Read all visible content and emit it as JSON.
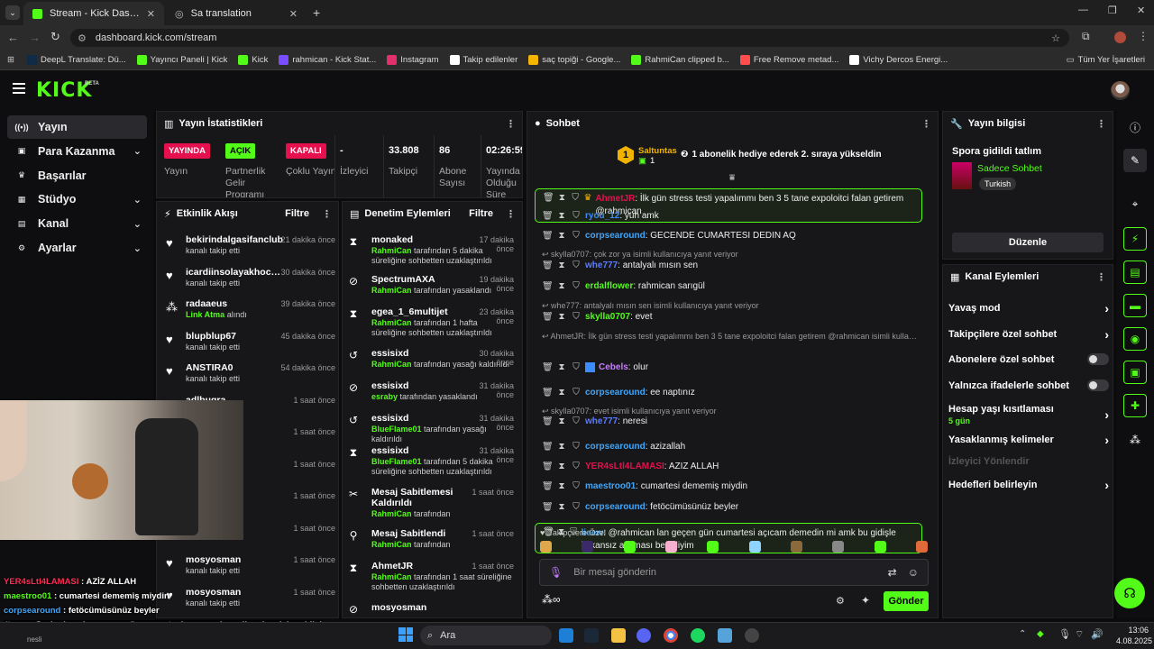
{
  "browser": {
    "tabs": [
      {
        "title": "Stream - Kick Dashboard",
        "active": true
      },
      {
        "title": "Sa translation",
        "active": false
      }
    ],
    "url": "dashboard.kick.com/stream",
    "bookmarks": [
      "DeepL Translate: Dü...",
      "Yayıncı Paneli | Kick",
      "Kick",
      "rahmican - Kick Stat...",
      "Instagram",
      "Takip edilenler",
      "saç topiği - Google...",
      "RahmiCan clipped b...",
      "Free Remove metad...",
      "Vichy Dercos Energi..."
    ],
    "all_bookmarks": "Tüm Yer İşaretleri"
  },
  "kick": {
    "logo": "KICK",
    "beta": "BETA"
  },
  "nav": {
    "items": [
      {
        "label": "Yayın",
        "icon": "broadcast-icon",
        "active": true
      },
      {
        "label": "Para Kazanma",
        "icon": "money-icon",
        "chevron": true
      },
      {
        "label": "Başarılar",
        "icon": "trophy-icon"
      },
      {
        "label": "Stüdyo",
        "icon": "studio-icon",
        "chevron": true
      },
      {
        "label": "Kanal",
        "icon": "channel-icon",
        "chevron": true
      },
      {
        "label": "Ayarlar",
        "icon": "gear-icon",
        "chevron": true
      }
    ]
  },
  "stats": {
    "title": "Yayın İstatistikleri",
    "items": [
      {
        "value": "YAYINDA",
        "label": "Yayın",
        "pill": "#e5104d"
      },
      {
        "value": "AÇIK",
        "label": "Partnerlik Gelir Programı",
        "pill": "#53fc18"
      },
      {
        "value": "KAPALI",
        "label": "Çoklu Yayın",
        "pill": "#e5104d"
      },
      {
        "value": "-",
        "label": "İzleyici"
      },
      {
        "value": "33.808",
        "label": "Takipçi"
      },
      {
        "value": "86",
        "label": "Abone Sayısı"
      },
      {
        "value": "02:26:59",
        "label": "Yayında Olduğu Süre"
      }
    ]
  },
  "activity": {
    "title": "Etkinlik Akışı",
    "filter": "Filtre",
    "items": [
      {
        "user": "bekirindalgasifanclub",
        "sub": "kanalı takip etti",
        "time": "21 dakika önce"
      },
      {
        "user": "icardiinsolayakhocam",
        "sub": "kanalı takip etti",
        "time": "30 dakika önce"
      },
      {
        "user": "radaaeus",
        "sub_green": "Link Atma",
        "sub": "alındı",
        "time": "39 dakika önce"
      },
      {
        "user": "blupblup67",
        "sub": "kanalı takip etti",
        "time": "45 dakika önce"
      },
      {
        "user": "ANSTIRA0",
        "sub": "kanalı takip etti",
        "time": "54 dakika önce"
      },
      {
        "user": "adlbugra",
        "sub": "",
        "time": "1 saat önce"
      },
      {
        "user": "213",
        "sub": "",
        "time": "1 saat önce"
      },
      {
        "user": "",
        "sub": "",
        "time": "1 saat önce"
      },
      {
        "user": "",
        "sub": "",
        "time": "1 saat önce"
      },
      {
        "user": "",
        "sub": "kanalı takip etti",
        "time": "1 saat önce"
      },
      {
        "user": "mosyosman",
        "sub": "kanalı takip etti",
        "time": "1 saat önce"
      },
      {
        "user": "mosyosman",
        "sub": "kanalı takip etti",
        "time": "1 saat önce"
      }
    ]
  },
  "moderation": {
    "title": "Denetim Eylemleri",
    "filter": "Filtre",
    "items": [
      {
        "user": "monaked",
        "by": "RahmiCan",
        "text": "tarafından 5 dakika süreliğine sohbetten uzaklaştırıldı",
        "time": "17 dakika önce",
        "icon": "hourglass-icon"
      },
      {
        "user": "SpectrumAXA",
        "by": "RahmiCan",
        "text": "tarafından yasaklandı",
        "time": "19 dakika önce",
        "icon": "ban-icon"
      },
      {
        "user": "egea_1_6multijet",
        "by": "RahmiCan",
        "text": "tarafından 1 hafta süreliğine sohbetten uzaklaştırıldı",
        "time": "23 dakika önce",
        "icon": "hourglass-icon"
      },
      {
        "user": "essisixd",
        "by": "RahmiCan",
        "text": "tarafından yasağı kaldırıldı",
        "time": "30 dakika önce",
        "icon": "undo-icon"
      },
      {
        "user": "essisixd",
        "by": "esraby",
        "text": "tarafından yasaklandı",
        "time": "31 dakika önce",
        "icon": "ban-icon"
      },
      {
        "user": "essisixd",
        "by": "BlueFlame01",
        "text": "tarafından yasağı kaldırıldı",
        "time": "31 dakika önce",
        "icon": "undo-icon"
      },
      {
        "user": "essisixd",
        "by": "BlueFlame01",
        "text": "tarafından 5 dakika süreliğine sohbetten uzaklaştırıldı",
        "time": "31 dakika önce",
        "icon": "hourglass-icon"
      },
      {
        "user": "Mesaj Sabitlemesi Kaldırıldı",
        "by": "RahmiCan",
        "text": "tarafından",
        "time": "1 saat önce",
        "icon": "unpin-icon"
      },
      {
        "user": "Mesaj Sabitlendi",
        "by": "RahmiCan",
        "text": "tarafından",
        "time": "1 saat önce",
        "icon": "pin-icon"
      },
      {
        "user": "AhmetJR",
        "by": "RahmiCan",
        "text": "tarafından 1 saat süreliğine sohbetten uzaklaştırıldı",
        "time": "1 saat önce",
        "icon": "hourglass-icon"
      },
      {
        "user": "mosyosman",
        "by": "",
        "text": "",
        "time": "",
        "icon": "ban-icon"
      }
    ]
  },
  "chat": {
    "title": "Sohbet",
    "gift_user": "Saltuntas",
    "gift_count": "1",
    "gift_text": "1 abonelik hediye ederek 2. sıraya yükseldin",
    "messages": [
      {
        "type": "msg",
        "user": "AhmetJR",
        "color": "#e5104d",
        "text": "İlk gün stress testi yapalımmı ben 3 5 tane expoloitci falan getirem @rahmican",
        "highlight": true,
        "crown": true
      },
      {
        "type": "msg",
        "user": "ryou_12",
        "color": "#3d8cff",
        "text": "yuh amk"
      },
      {
        "type": "msg",
        "user": "corpsearound",
        "color": "#42a5f5",
        "text": "GECENDE CUMARTESI DEDIN AQ"
      },
      {
        "type": "reply",
        "text": "skylla0707: çok zor ya isimli kullanıcıya yanıt veriyor"
      },
      {
        "type": "msg",
        "user": "whe777",
        "color": "#5b7bff",
        "text": "antalyalı mısın sen"
      },
      {
        "type": "msg",
        "user": "erdalflower",
        "color": "#53fc18",
        "text": "rahmican sarıgül"
      },
      {
        "type": "reply",
        "text": "whe777: antalyalı mısın sen isimli kullanıcıya yanıt veriyor"
      },
      {
        "type": "msg",
        "user": "skylla0707",
        "color": "#53fc18",
        "text": "evet"
      },
      {
        "type": "reply",
        "text": "AhmetJR: İlk gün stress testi yapalımmı ben 3 5 tane expoloitci falan getirem @rahmican isimli kullanıcıya y..."
      },
      {
        "type": "msg",
        "user": "Cebels",
        "color": "#c77dff",
        "text": "olur",
        "badge": true
      },
      {
        "type": "msg",
        "user": "corpsearound",
        "color": "#42a5f5",
        "text": "ee naptınız"
      },
      {
        "type": "reply",
        "text": "skylla0707: evet isimli kullanıcıya yanıt veriyor"
      },
      {
        "type": "msg",
        "user": "whe777",
        "color": "#5b7bff",
        "text": "neresi"
      },
      {
        "type": "msg",
        "user": "corpsearound",
        "color": "#42a5f5",
        "text": "azizallah"
      },
      {
        "type": "msg",
        "user": "YER4sLtl4LAMASI",
        "color": "#e5104d",
        "text": "AZİZ ALLAH"
      },
      {
        "type": "msg",
        "user": "maestroo01",
        "color": "#42a5f5",
        "text": "cumartesi dememiş miydin"
      },
      {
        "type": "msg",
        "user": "corpsearound",
        "color": "#42a5f5",
        "text": "fetöcümüsünüz beyler"
      },
      {
        "type": "msg",
        "user": "lieew",
        "color": "#42a5f5",
        "text": "@rahmican lan geçen gün cumartesi açıcam demedin mi amk bu gidişle imkansız açılması ben diyim",
        "highlight": true
      }
    ],
    "followers_only": "Takipçilere Özel",
    "placeholder": "Bir mesaj gönderin",
    "send": "Gönder"
  },
  "info": {
    "title": "Yayın bilgisi",
    "stream_title": "Spora gidildi tatlım",
    "category": "Sadece Sohbet",
    "tag": "Turkish",
    "edit": "Düzenle"
  },
  "channel_actions": {
    "title": "Kanal Eylemleri",
    "items": [
      {
        "label": "Yavaş mod",
        "kind": "chevron"
      },
      {
        "label": "Takipçilere özel sohbet",
        "kind": "chevron"
      },
      {
        "label": "Abonelere özel sohbet",
        "kind": "toggle"
      },
      {
        "label": "Yalnızca ifadelerle sohbet",
        "kind": "toggle"
      },
      {
        "label": "Hesap yaşı kısıtlaması",
        "sub": "5 gün",
        "kind": "chevron"
      },
      {
        "label": "Yasaklanmış kelimeler",
        "kind": "chevron"
      },
      {
        "label": "İzleyici Yönlendir",
        "kind": "disabled"
      },
      {
        "label": "Hedefleri belirleyin",
        "kind": "chevron"
      }
    ]
  },
  "overlay_chat": [
    {
      "user": "YER4sLtl4LAMASI",
      "color": "#ff2d55",
      "text": "AZİZ ALLAH"
    },
    {
      "user": "maestroo01",
      "color": "#53fc18",
      "text": "cumartesi dememiş miydin"
    },
    {
      "user": "corpsearound",
      "color": "#42a5f5",
      "text": "fetöcümüsünüz beyler"
    },
    {
      "user": "lieew",
      "color": "#42a5f5",
      "text": "@rahmican lan geçen gün cumartesi açıcam demedin mi amk bu gidişl"
    },
    {
      "user": "",
      "color": "#ffffff",
      "text": "ben diyim"
    }
  ],
  "taskbar": {
    "search": "Ara",
    "time": "13:06",
    "date": "4.08.2025",
    "sub_fragment": "nesli"
  }
}
